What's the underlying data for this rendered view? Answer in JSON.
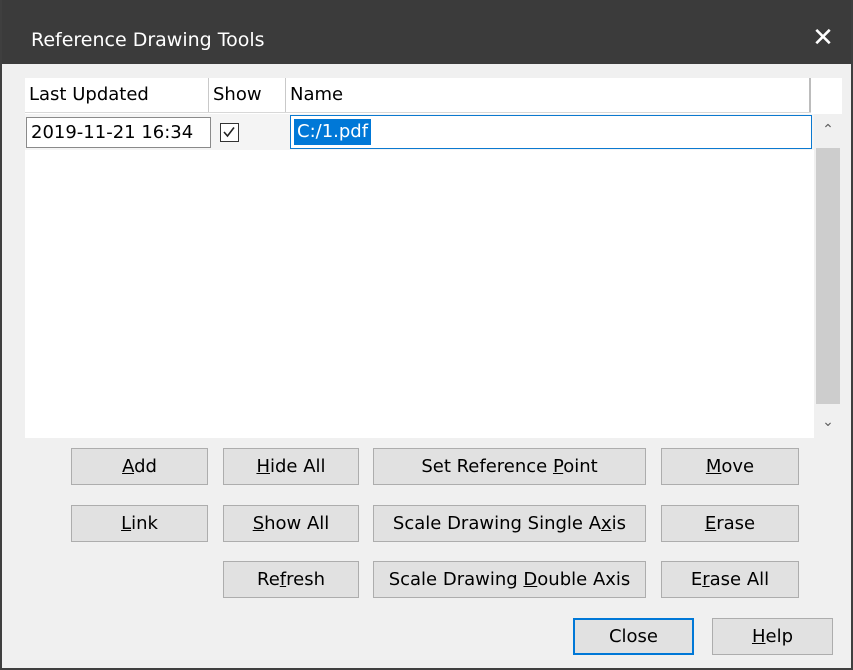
{
  "window": {
    "title": "Reference Drawing Tools",
    "close_glyph": "✕"
  },
  "table": {
    "columns": [
      "Last Updated",
      "Show",
      "Name"
    ],
    "rows": [
      {
        "last_updated": "2019-11-21 16:34",
        "show": true,
        "name": "C:/1.pdf"
      }
    ]
  },
  "scrollbar": {
    "up_glyph": "⌃",
    "down_glyph": "⌄"
  },
  "buttons": {
    "add": {
      "pre": "",
      "key": "A",
      "post": "dd"
    },
    "hide_all": {
      "pre": "",
      "key": "H",
      "post": "ide All"
    },
    "set_reference_point": {
      "pre": "Set Reference ",
      "key": "P",
      "post": "oint"
    },
    "move": {
      "pre": "",
      "key": "M",
      "post": "ove"
    },
    "link": {
      "pre": "",
      "key": "L",
      "post": "ink"
    },
    "show_all": {
      "pre": "",
      "key": "S",
      "post": "how All"
    },
    "scale_single": {
      "pre": "Scale Drawing Single A",
      "key": "x",
      "post": "is"
    },
    "erase": {
      "pre": "",
      "key": "E",
      "post": "rase"
    },
    "refresh": {
      "pre": "Re",
      "key": "f",
      "post": "resh"
    },
    "scale_double": {
      "pre": "Scale Drawing ",
      "key": "D",
      "post": "ouble Axis"
    },
    "erase_all": {
      "pre": "E",
      "key": "r",
      "post": "ase All"
    },
    "close": {
      "pre": "Close",
      "key": "",
      "post": ""
    },
    "help": {
      "pre": "",
      "key": "H",
      "post": "elp"
    }
  },
  "colors": {
    "titlebar": "#3b3b3b",
    "selection": "#0078d7",
    "button_face": "#e1e1e1"
  }
}
